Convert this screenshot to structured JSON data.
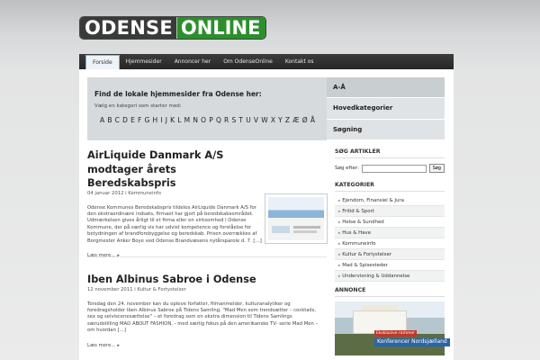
{
  "logo": {
    "part1": "ODENSE",
    "part2": "ONLINE"
  },
  "nav": [
    {
      "label": "Forside",
      "active": true
    },
    {
      "label": "Hjemmesider"
    },
    {
      "label": "Annoncer her"
    },
    {
      "label": "Om OdenseOnline"
    },
    {
      "label": "Kontakt os"
    }
  ],
  "hero": {
    "title": "Find de lokale hjemmesider fra Odense her:",
    "subtitle": "Vælg en kategori som starter med:",
    "letters": [
      "A",
      "B",
      "C",
      "D",
      "E",
      "F",
      "G",
      "H",
      "I",
      "J",
      "K",
      "L",
      "M",
      "N",
      "O",
      "P",
      "Q",
      "R",
      "S",
      "T",
      "U",
      "V",
      "W",
      "X",
      "Y",
      "Z",
      "Æ",
      "Ø",
      "Å"
    ]
  },
  "tabs": [
    "A-Å",
    "Hovedkategorier",
    "Søgning"
  ],
  "posts": [
    {
      "title": "AirLiquide Danmark A/S modtager årets Beredskabspris",
      "meta": "04 januar 2012 i Kommuneinfo",
      "body": "Odense Kommunes Beredskabspris tildeles AirLiquide Danmark A/S for den ekstraordinære indsats, firmaet har gjort på beredskabsområdet. Udmærkelsen gives årligt til et firma eller en virksomhed i Odense Kommune, der på særlig vis har udvist kompetence og forståelse for betydningen af brandforebyggelse og beredskab. Prisen overrækkes af Borgmester Anker Boye ved Odense Brandvæsens nytårsparole d. 7. […]",
      "readmore": "Læs mere..."
    },
    {
      "title": "Iben Albinus Sabroe i Odense",
      "meta": "12 november 2011 i Kultur & Fortystelser",
      "body": "Torsdag den 24. november kan du opleve forfatter, filmanmelder, kulturanalytiker og foredragsholder Iben Albinus Sabroe på Tidens Samling. \"Mad Men som trendsætter – cocktails, sex og selviscenesættelse\" – et foredrag som en ekstra dimension til Tidens Samlings særudstilling MAD ABOUT FASHION, - med særlig fokus på den amerikanske TV- serie Mad Men – om hvordan […]",
      "readmore": "Læs mere..."
    }
  ],
  "sidebar": {
    "search_heading": "SØG ARTIKLER",
    "search_label": "Søg efter:",
    "search_value": "",
    "search_button": "Søg",
    "categories_heading": "KATEGORIER",
    "categories": [
      "Ejendom, Finansiel & Jura",
      "Fritid & Sport",
      "Helse & Sundhed",
      "Hus & Have",
      "Kommuneinfo",
      "Kultur & Forlystelser",
      "Mad & Spisesteder",
      "Undervisning & Uddannelse"
    ],
    "ad_heading": "ANNONCE",
    "ad_text1": "Eksklusive rammer",
    "ad_text2": "Konferencer Nordsjælland"
  }
}
